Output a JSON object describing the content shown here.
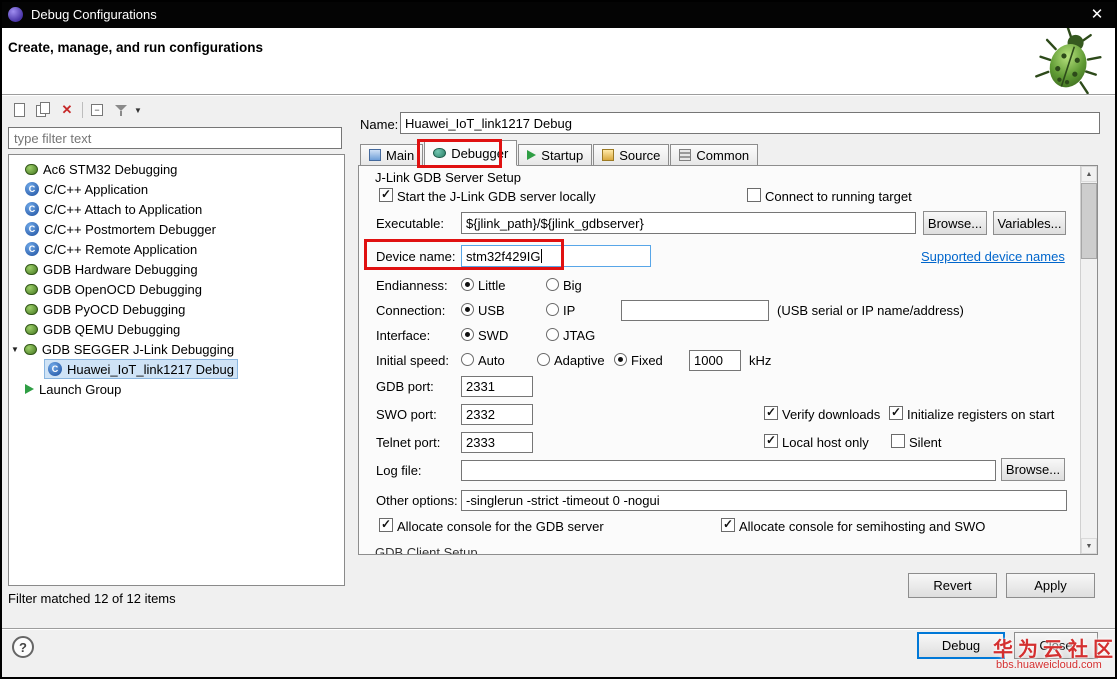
{
  "colors": {
    "accent_blue": "#0078d7",
    "annotation_red": "#e01111",
    "link_blue": "#0066cc",
    "selection_bg": "#cfe3f6"
  },
  "icons": {
    "close": "✕",
    "delete": "✕",
    "help": "?",
    "dropdown": "▼",
    "tree_expanded": "▼",
    "scroll_up": "▲",
    "scroll_down": "▼",
    "check": "✓",
    "c_glyph": "C",
    "collapse_glyph": "−"
  },
  "window": {
    "title": "Debug Configurations"
  },
  "header": {
    "title": "Create, manage, and run configurations"
  },
  "sidebar": {
    "filter_placeholder": "type filter text",
    "items": [
      {
        "label": "Ac6 STM32 Debugging",
        "icon": "bug-icon"
      },
      {
        "label": "C/C++ Application",
        "icon": "c-application-icon"
      },
      {
        "label": "C/C++ Attach to Application",
        "icon": "c-application-icon"
      },
      {
        "label": "C/C++ Postmortem Debugger",
        "icon": "c-application-icon"
      },
      {
        "label": "C/C++ Remote Application",
        "icon": "c-application-icon"
      },
      {
        "label": "GDB Hardware Debugging",
        "icon": "bug-icon"
      },
      {
        "label": "GDB OpenOCD Debugging",
        "icon": "bug-icon"
      },
      {
        "label": "GDB PyOCD Debugging",
        "icon": "bug-icon"
      },
      {
        "label": "GDB QEMU Debugging",
        "icon": "bug-icon"
      },
      {
        "label": "GDB SEGGER J-Link Debugging",
        "icon": "bug-icon",
        "expanded": true
      },
      {
        "label": "Huawei_IoT_link1217 Debug",
        "icon": "c-application-icon",
        "selected": true
      },
      {
        "label": "Launch Group",
        "icon": "launch-group-icon"
      }
    ],
    "status": "Filter matched 12 of 12 items"
  },
  "form": {
    "name_label": "Name:",
    "name_value": "Huawei_IoT_link1217 Debug",
    "tabs": [
      {
        "label": "Main",
        "icon": "main-tab-icon"
      },
      {
        "label": "Debugger",
        "icon": "debugger-tab-icon",
        "active": true
      },
      {
        "label": "Startup",
        "icon": "startup-tab-icon"
      },
      {
        "label": "Source",
        "icon": "source-tab-icon"
      },
      {
        "label": "Common",
        "icon": "common-tab-icon"
      }
    ],
    "server_group": {
      "title": "J-Link GDB Server Setup",
      "start_locally": {
        "label": "Start the J-Link GDB server locally",
        "checked": true
      },
      "connect_running": {
        "label": "Connect to running target",
        "checked": false
      },
      "executable_label": "Executable:",
      "executable_value": "${jlink_path}/${jlink_gdbserver}",
      "browse_button": "Browse...",
      "variables_button": "Variables...",
      "device_label": "Device name:",
      "device_value": "stm32f429IG",
      "supported_link": "Supported device names",
      "endianness_label": "Endianness:",
      "endianness_options": [
        "Little",
        "Big"
      ],
      "endianness_selected": "Little",
      "connection_label": "Connection:",
      "connection_options": [
        "USB",
        "IP"
      ],
      "connection_selected": "USB",
      "connection_value": "",
      "connection_hint": "(USB serial or IP name/address)",
      "interface_label": "Interface:",
      "interface_options": [
        "SWD",
        "JTAG"
      ],
      "interface_selected": "SWD",
      "speed_label": "Initial speed:",
      "speed_options": [
        "Auto",
        "Adaptive",
        "Fixed"
      ],
      "speed_selected": "Fixed",
      "speed_value": "1000",
      "speed_unit": "kHz",
      "gdb_port_label": "GDB port:",
      "gdb_port_value": "2331",
      "swo_port_label": "SWO port:",
      "swo_port_value": "2332",
      "verify_downloads": {
        "label": "Verify downloads",
        "checked": true
      },
      "init_registers": {
        "label": "Initialize registers on start",
        "checked": true
      },
      "telnet_port_label": "Telnet port:",
      "telnet_port_value": "2333",
      "local_host_only": {
        "label": "Local host only",
        "checked": true
      },
      "silent": {
        "label": "Silent",
        "checked": false
      },
      "log_file_label": "Log file:",
      "log_file_value": "",
      "log_browse_button": "Browse...",
      "other_options_label": "Other options:",
      "other_options_value": "-singlerun -strict -timeout 0 -nogui",
      "alloc_gdb_console": {
        "label": "Allocate console for the GDB server",
        "checked": true
      },
      "alloc_semihosting_console": {
        "label": "Allocate console for semihosting and SWO",
        "checked": true
      }
    },
    "client_group_title": "GDB Client Setup",
    "revert_button": "Revert",
    "apply_button": "Apply"
  },
  "footer": {
    "debug_button": "Debug",
    "close_button": "Close"
  },
  "watermark": {
    "line1": "华为云社区",
    "line2": "bbs.huaweicloud.com"
  }
}
